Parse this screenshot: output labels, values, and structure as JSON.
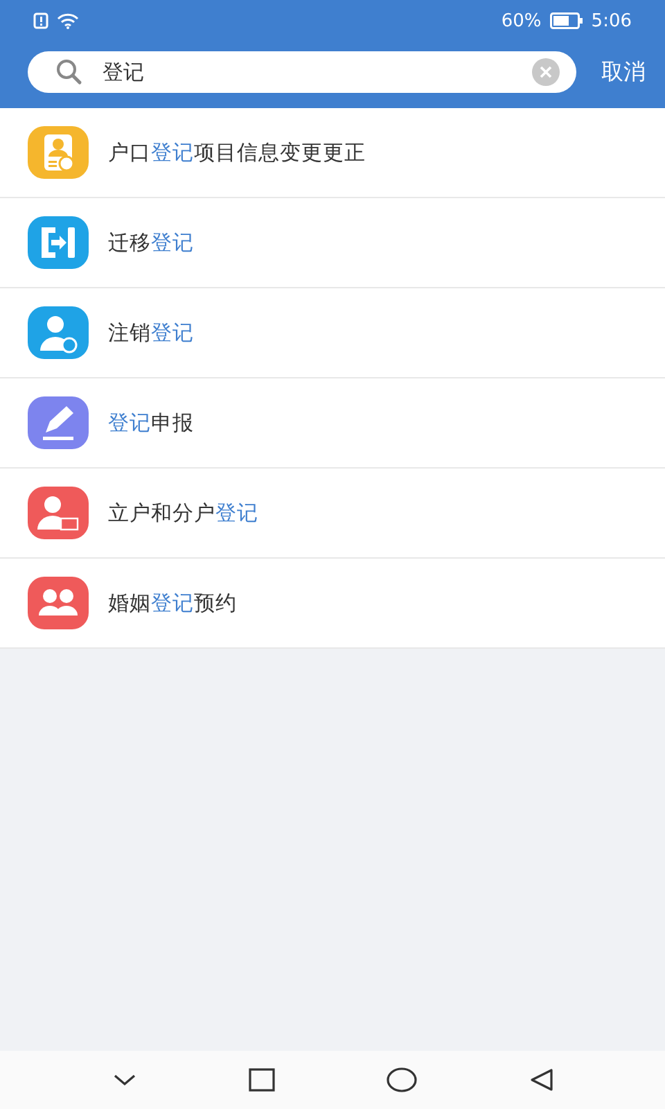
{
  "status_bar": {
    "battery_text": "60%",
    "time": "5:06"
  },
  "search": {
    "value": "登记",
    "cancel": "取消"
  },
  "results": [
    {
      "kind": "person-card",
      "color": "#f5b62d",
      "parts": [
        {
          "text": "户口",
          "highlight": false
        },
        {
          "text": "登记",
          "highlight": true
        },
        {
          "text": "项目信息变更更正",
          "highlight": false
        }
      ]
    },
    {
      "kind": "transfer",
      "color": "#1fa3e6",
      "parts": [
        {
          "text": "迁移",
          "highlight": false
        },
        {
          "text": "登记",
          "highlight": true
        }
      ]
    },
    {
      "kind": "person-badge",
      "color": "#1fa3e6",
      "parts": [
        {
          "text": "注销",
          "highlight": false
        },
        {
          "text": "登记",
          "highlight": true
        }
      ]
    },
    {
      "kind": "pencil",
      "color": "#7d84ee",
      "parts": [
        {
          "text": "登记",
          "highlight": true
        },
        {
          "text": "申报",
          "highlight": false
        }
      ]
    },
    {
      "kind": "person-id",
      "color": "#ef5a5a",
      "parts": [
        {
          "text": "立户和分户",
          "highlight": false
        },
        {
          "text": "登记",
          "highlight": true
        }
      ]
    },
    {
      "kind": "couple",
      "color": "#ef5a5a",
      "parts": [
        {
          "text": "婚姻",
          "highlight": false
        },
        {
          "text": "登记",
          "highlight": true
        },
        {
          "text": "预约",
          "highlight": false
        }
      ]
    }
  ]
}
